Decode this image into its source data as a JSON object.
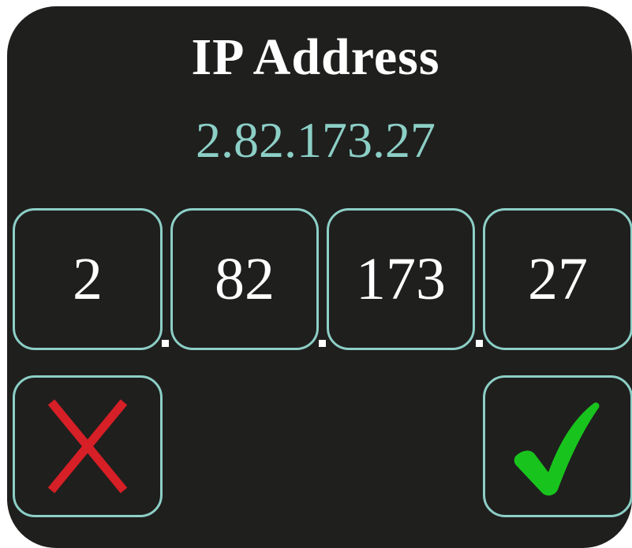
{
  "dialog": {
    "title": "IP Address",
    "ip_readout": "2.82.173.27",
    "octets": [
      "2",
      "82",
      "173",
      "27"
    ]
  },
  "actions": {
    "cancel_icon": "cancel-x-icon",
    "confirm_icon": "checkmark-icon"
  },
  "colors": {
    "background": "#1f1f1e",
    "accent": "#8ccfc6",
    "cancel": "#d61f26",
    "confirm": "#19c31d",
    "text": "#ffffff"
  }
}
